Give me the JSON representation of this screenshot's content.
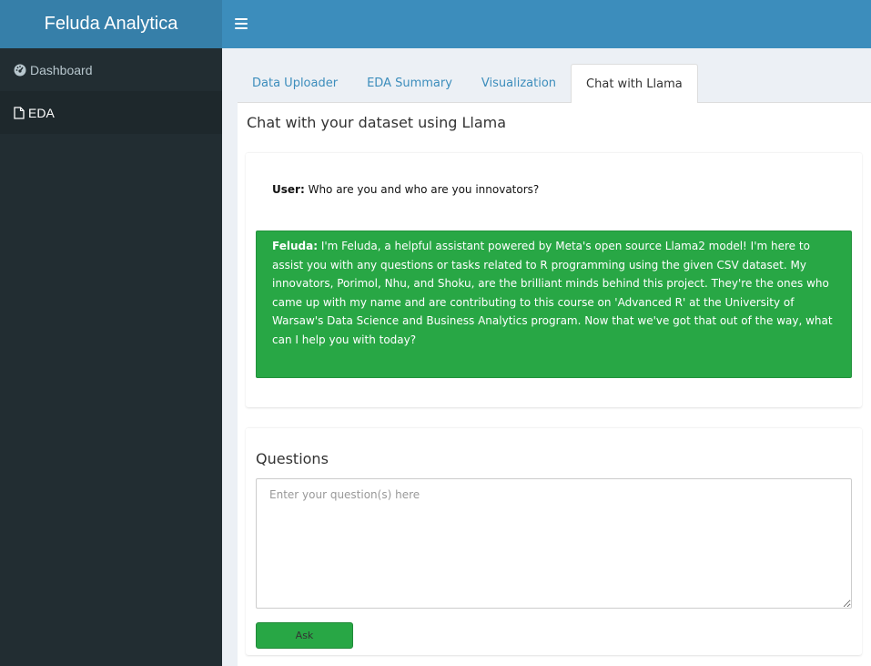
{
  "app": {
    "title": "Feluda Analytica"
  },
  "sidebar": {
    "items": [
      {
        "label": "Dashboard",
        "icon": "dashboard-icon"
      },
      {
        "label": "EDA",
        "icon": "file-icon"
      }
    ]
  },
  "tabs": [
    {
      "label": "Data Uploader"
    },
    {
      "label": "EDA Summary"
    },
    {
      "label": "Visualization"
    },
    {
      "label": "Chat with Llama",
      "active": true
    }
  ],
  "chat": {
    "title": "Chat with your dataset using Llama",
    "user_label": "User:",
    "user_text": "Who are you and who are you innovators?",
    "bot_label": "Feluda:",
    "bot_text": "I'm Feluda, a helpful assistant powered by Meta's open source Llama2 model! I'm here to assist you with any questions or tasks related to R programming using the given CSV dataset. My innovators, Porimol, Nhu, and Shoku, are the brilliant minds behind this project. They're the ones who came up with my name and are contributing to this course on 'Advanced R' at the University of Warsaw's Data Science and Business Analytics program. Now that we've got that out of the way, what can I help you with today?"
  },
  "questions": {
    "title": "Questions",
    "placeholder": "Enter your question(s) here",
    "value": "",
    "ask_label": "Ask"
  },
  "colors": {
    "header": "#3c8dbc",
    "logo": "#367fa9",
    "sidebar": "#222d32",
    "accent_green": "#28a745"
  }
}
